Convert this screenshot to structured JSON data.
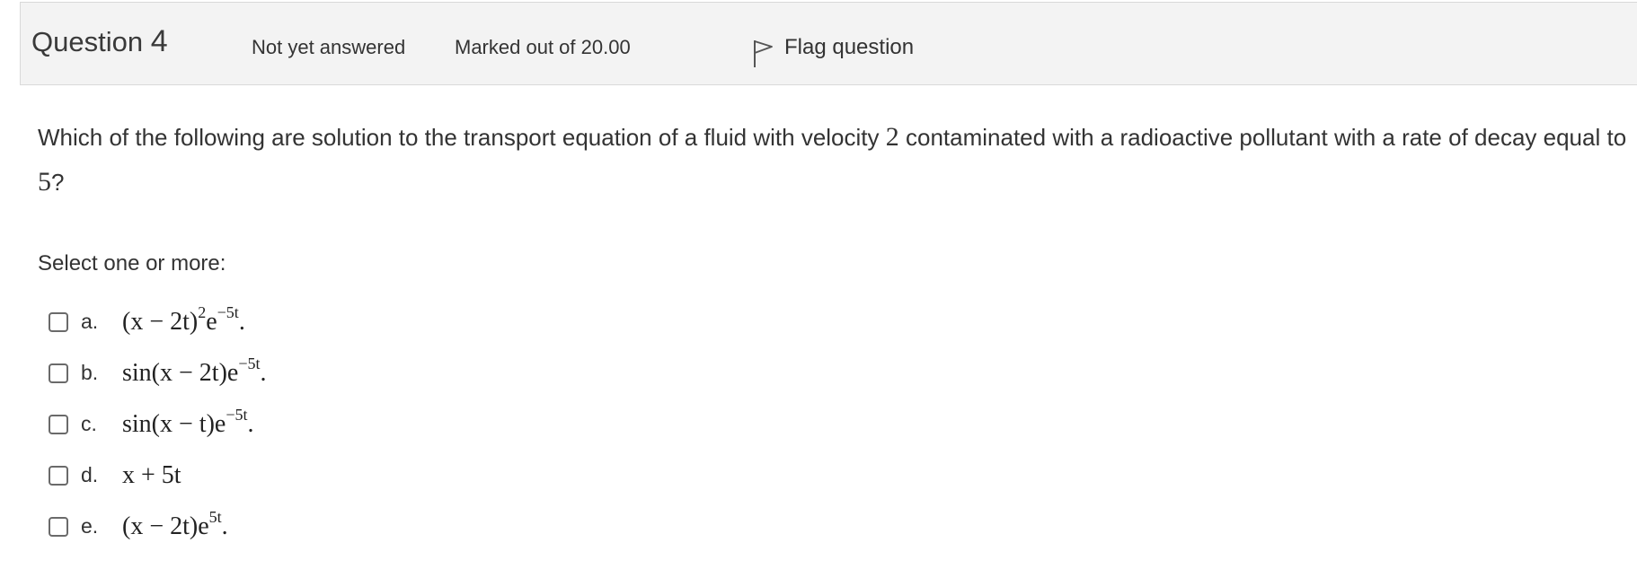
{
  "question_info": {
    "title_prefix": "Question",
    "number": "4",
    "state": "Not yet answered",
    "grade": "Marked out of 20.00",
    "flag_label": "Flag question"
  },
  "question": {
    "text_part1": "Which of the following are solution to the transport equation of a fluid with velocity",
    "velocity": "2",
    "text_part2": "contaminated with a radioactive pollutant with a rate of decay equal to",
    "decay_rate": "5",
    "text_end": "?"
  },
  "prompt": "Select one or more:",
  "answers": [
    {
      "letter": "a.",
      "base": "(x − 2t)",
      "sup1": "2",
      "mid": "e",
      "sup2": "−5t",
      "tail": "."
    },
    {
      "letter": "b.",
      "base": "sin(x − 2t)",
      "sup1": "",
      "mid": "e",
      "sup2": "−5t",
      "tail": "."
    },
    {
      "letter": "c.",
      "base": "sin(x − t)",
      "sup1": "",
      "mid": "e",
      "sup2": "−5t",
      "tail": "."
    },
    {
      "letter": "d.",
      "base": "x + 5t",
      "sup1": "",
      "mid": "",
      "sup2": "",
      "tail": ""
    },
    {
      "letter": "e.",
      "base": "(x − 2t)",
      "sup1": "",
      "mid": "e",
      "sup2": "5t",
      "tail": "."
    }
  ],
  "colors": {
    "info_bar_bg": "#f3f3f3",
    "info_bar_border": "#d9d9d9",
    "text": "#333333"
  },
  "icons": {
    "flag": "flag-outline-icon"
  }
}
